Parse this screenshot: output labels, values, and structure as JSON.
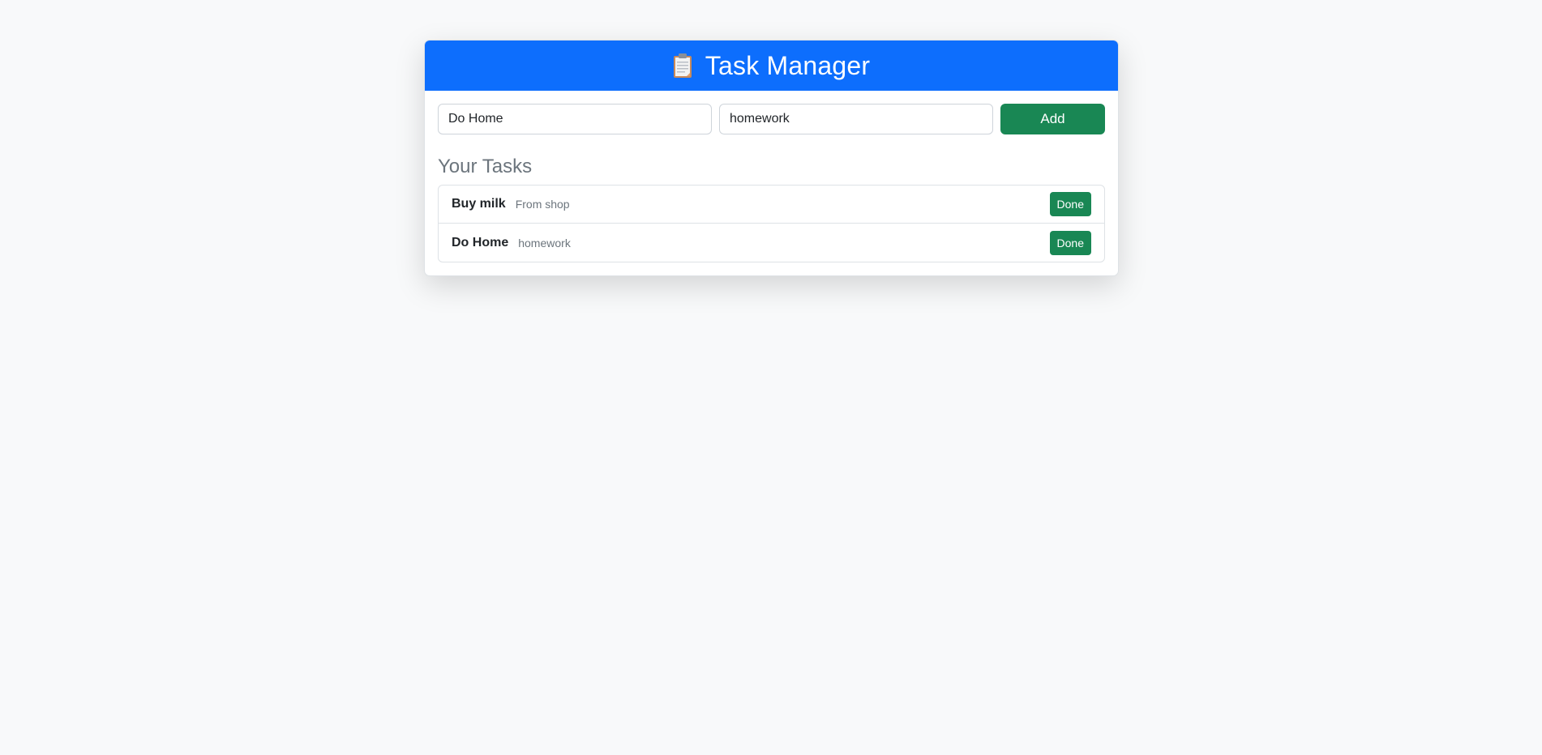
{
  "app": {
    "title": "Task Manager",
    "header_icon": "clipboard-icon"
  },
  "form": {
    "title_input_value": "Do Home",
    "description_input_value": "homework",
    "add_label": "Add"
  },
  "tasks_section": {
    "title": "Your Tasks",
    "items": [
      {
        "title": "Buy milk",
        "description": "From shop",
        "done_label": "Done"
      },
      {
        "title": "Do Home",
        "description": "homework",
        "done_label": "Done"
      }
    ]
  },
  "colors": {
    "primary": "#0d6efd",
    "success": "#198754",
    "background": "#f8f9fa"
  }
}
